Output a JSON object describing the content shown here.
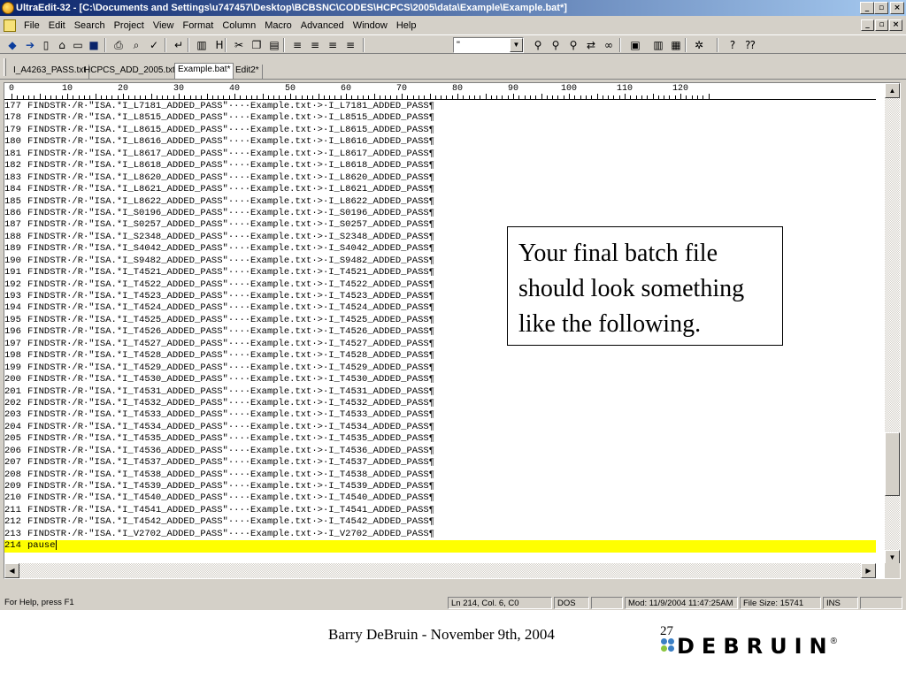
{
  "window": {
    "title": "UltraEdit-32 - [C:\\Documents and Settings\\u747457\\Desktop\\BCBSNC\\CODES\\HCPCS\\2005\\data\\Example\\Example.bat*]",
    "buttons": {
      "minimize": "_",
      "maximize": "▫",
      "close": "×"
    }
  },
  "menu": [
    "File",
    "Edit",
    "Search",
    "Project",
    "View",
    "Format",
    "Column",
    "Macro",
    "Advanced",
    "Window",
    "Help"
  ],
  "toolbar": {
    "combo_value": "\"",
    "icons": [
      "back-icon",
      "forward-icon",
      "new-file-icon",
      "open-icon",
      "folder-icon",
      "save-icon",
      "print-icon",
      "print-preview-icon",
      "spellcheck-icon",
      "word-wrap-icon",
      "column-mode-icon",
      "hex-icon",
      "cut-icon",
      "copy-icon",
      "paste-icon",
      "align-left-icon",
      "align-center-icon",
      "align-right-icon",
      "justify-icon",
      "find-icon",
      "find-next-icon",
      "find-prev-icon",
      "replace-icon",
      "binoculars-icon",
      "macro-icon",
      "split-icon",
      "window-icon",
      "settings-icon",
      "help-icon",
      "context-help-icon"
    ]
  },
  "tabs": [
    "I_A4263_PASS.txt",
    "HCPCS_ADD_2005.txt",
    "Example.bat*",
    "Edit2*"
  ],
  "active_tab": 2,
  "ruler": {
    "marks": [
      "0",
      "10",
      "20",
      "30",
      "40",
      "50",
      "60",
      "70",
      "80",
      "90",
      "100",
      "110",
      "120"
    ]
  },
  "editor": {
    "lines": [
      {
        "n": "177",
        "text": "FINDSTR·/R·\"ISA.*I_L7181_ADDED_PASS\"····Example.txt·>·I_L7181_ADDED_PASS¶"
      },
      {
        "n": "178",
        "text": "FINDSTR·/R·\"ISA.*I_L8515_ADDED_PASS\"····Example.txt·>·I_L8515_ADDED_PASS¶"
      },
      {
        "n": "179",
        "text": "FINDSTR·/R·\"ISA.*I_L8615_ADDED_PASS\"····Example.txt·>·I_L8615_ADDED_PASS¶"
      },
      {
        "n": "180",
        "text": "FINDSTR·/R·\"ISA.*I_L8616_ADDED_PASS\"····Example.txt·>·I_L8616_ADDED_PASS¶"
      },
      {
        "n": "181",
        "text": "FINDSTR·/R·\"ISA.*I_L8617_ADDED_PASS\"····Example.txt·>·I_L8617_ADDED_PASS¶"
      },
      {
        "n": "182",
        "text": "FINDSTR·/R·\"ISA.*I_L8618_ADDED_PASS\"····Example.txt·>·I_L8618_ADDED_PASS¶"
      },
      {
        "n": "183",
        "text": "FINDSTR·/R·\"ISA.*I_L8620_ADDED_PASS\"····Example.txt·>·I_L8620_ADDED_PASS¶"
      },
      {
        "n": "184",
        "text": "FINDSTR·/R·\"ISA.*I_L8621_ADDED_PASS\"····Example.txt·>·I_L8621_ADDED_PASS¶"
      },
      {
        "n": "185",
        "text": "FINDSTR·/R·\"ISA.*I_L8622_ADDED_PASS\"····Example.txt·>·I_L8622_ADDED_PASS¶"
      },
      {
        "n": "186",
        "text": "FINDSTR·/R·\"ISA.*I_S0196_ADDED_PASS\"····Example.txt·>·I_S0196_ADDED_PASS¶"
      },
      {
        "n": "187",
        "text": "FINDSTR·/R·\"ISA.*I_S0257_ADDED_PASS\"····Example.txt·>·I_S0257_ADDED_PASS¶"
      },
      {
        "n": "188",
        "text": "FINDSTR·/R·\"ISA.*I_S2348_ADDED_PASS\"····Example.txt·>·I_S2348_ADDED_PASS¶"
      },
      {
        "n": "189",
        "text": "FINDSTR·/R·\"ISA.*I_S4042_ADDED_PASS\"····Example.txt·>·I_S4042_ADDED_PASS¶"
      },
      {
        "n": "190",
        "text": "FINDSTR·/R·\"ISA.*I_S9482_ADDED_PASS\"····Example.txt·>·I_S9482_ADDED_PASS¶"
      },
      {
        "n": "191",
        "text": "FINDSTR·/R·\"ISA.*I_T4521_ADDED_PASS\"····Example.txt·>·I_T4521_ADDED_PASS¶"
      },
      {
        "n": "192",
        "text": "FINDSTR·/R·\"ISA.*I_T4522_ADDED_PASS\"····Example.txt·>·I_T4522_ADDED_PASS¶"
      },
      {
        "n": "193",
        "text": "FINDSTR·/R·\"ISA.*I_T4523_ADDED_PASS\"····Example.txt·>·I_T4523_ADDED_PASS¶"
      },
      {
        "n": "194",
        "text": "FINDSTR·/R·\"ISA.*I_T4524_ADDED_PASS\"····Example.txt·>·I_T4524_ADDED_PASS¶"
      },
      {
        "n": "195",
        "text": "FINDSTR·/R·\"ISA.*I_T4525_ADDED_PASS\"····Example.txt·>·I_T4525_ADDED_PASS¶"
      },
      {
        "n": "196",
        "text": "FINDSTR·/R·\"ISA.*I_T4526_ADDED_PASS\"····Example.txt·>·I_T4526_ADDED_PASS¶"
      },
      {
        "n": "197",
        "text": "FINDSTR·/R·\"ISA.*I_T4527_ADDED_PASS\"····Example.txt·>·I_T4527_ADDED_PASS¶"
      },
      {
        "n": "198",
        "text": "FINDSTR·/R·\"ISA.*I_T4528_ADDED_PASS\"····Example.txt·>·I_T4528_ADDED_PASS¶"
      },
      {
        "n": "199",
        "text": "FINDSTR·/R·\"ISA.*I_T4529_ADDED_PASS\"····Example.txt·>·I_T4529_ADDED_PASS¶"
      },
      {
        "n": "200",
        "text": "FINDSTR·/R·\"ISA.*I_T4530_ADDED_PASS\"····Example.txt·>·I_T4530_ADDED_PASS¶"
      },
      {
        "n": "201",
        "text": "FINDSTR·/R·\"ISA.*I_T4531_ADDED_PASS\"····Example.txt·>·I_T4531_ADDED_PASS¶"
      },
      {
        "n": "202",
        "text": "FINDSTR·/R·\"ISA.*I_T4532_ADDED_PASS\"····Example.txt·>·I_T4532_ADDED_PASS¶"
      },
      {
        "n": "203",
        "text": "FINDSTR·/R·\"ISA.*I_T4533_ADDED_PASS\"····Example.txt·>·I_T4533_ADDED_PASS¶"
      },
      {
        "n": "204",
        "text": "FINDSTR·/R·\"ISA.*I_T4534_ADDED_PASS\"····Example.txt·>·I_T4534_ADDED_PASS¶"
      },
      {
        "n": "205",
        "text": "FINDSTR·/R·\"ISA.*I_T4535_ADDED_PASS\"····Example.txt·>·I_T4535_ADDED_PASS¶"
      },
      {
        "n": "206",
        "text": "FINDSTR·/R·\"ISA.*I_T4536_ADDED_PASS\"····Example.txt·>·I_T4536_ADDED_PASS¶"
      },
      {
        "n": "207",
        "text": "FINDSTR·/R·\"ISA.*I_T4537_ADDED_PASS\"····Example.txt·>·I_T4537_ADDED_PASS¶"
      },
      {
        "n": "208",
        "text": "FINDSTR·/R·\"ISA.*I_T4538_ADDED_PASS\"····Example.txt·>·I_T4538_ADDED_PASS¶"
      },
      {
        "n": "209",
        "text": "FINDSTR·/R·\"ISA.*I_T4539_ADDED_PASS\"····Example.txt·>·I_T4539_ADDED_PASS¶"
      },
      {
        "n": "210",
        "text": "FINDSTR·/R·\"ISA.*I_T4540_ADDED_PASS\"····Example.txt·>·I_T4540_ADDED_PASS¶"
      },
      {
        "n": "211",
        "text": "FINDSTR·/R·\"ISA.*I_T4541_ADDED_PASS\"····Example.txt·>·I_T4541_ADDED_PASS¶"
      },
      {
        "n": "212",
        "text": "FINDSTR·/R·\"ISA.*I_T4542_ADDED_PASS\"····Example.txt·>·I_T4542_ADDED_PASS¶"
      },
      {
        "n": "213",
        "text": "FINDSTR·/R·\"ISA.*I_V2702_ADDED_PASS\"····Example.txt·>·I_V2702_ADDED_PASS¶"
      },
      {
        "n": "214",
        "text": "pause"
      }
    ],
    "highlight_color": "#ffff00",
    "vertical_scroll_position": 0.86
  },
  "statusbar": {
    "help": "For Help, press F1",
    "position": "Ln 214, Col. 6, C0",
    "format": "DOS",
    "modified": "Mod: 11/9/2004 11:47:25AM",
    "file_size": "File Size: 15741",
    "mode": "INS"
  },
  "callout": {
    "text": "Your final batch file should look something like the following."
  },
  "footer": {
    "author_date": "Barry DeBruin - November 9th, 2004",
    "page": "27",
    "logo_text": "DEBRUIN",
    "logo_reg": "®"
  },
  "colors": {
    "titlebar_start": "#0a246a",
    "titlebar_end": "#a6caf0",
    "chrome": "#d4d0c8",
    "logo_blue": "#3b7fc4",
    "logo_green": "#8bc53f"
  }
}
